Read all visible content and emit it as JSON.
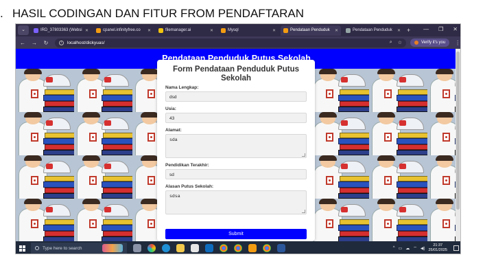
{
  "slide": {
    "number": ".",
    "title": "HASIL CODINGAN DAN FITUR FROM PENDAFTARAN"
  },
  "browser": {
    "tabs": [
      {
        "label": "IRD_37803363 (Websi",
        "color": "#7b61ff",
        "active": false
      },
      {
        "label": "cpanel.infinityfree.co",
        "color": "#f39c12",
        "active": false
      },
      {
        "label": "filemanager.ai",
        "color": "#f1c40f",
        "active": false
      },
      {
        "label": "Mysql",
        "color": "#f39c12",
        "active": false
      },
      {
        "label": "Pendataan Penduduk",
        "color": "#f39c12",
        "active": true
      },
      {
        "label": "Pendataan Penduduk",
        "color": "#95a5a6",
        "active": false
      }
    ],
    "url": "localhost/dickyuas/",
    "verify_label": "Verify it's you"
  },
  "page": {
    "banner": "Pendataan Penduduk Putus Sekolah",
    "form": {
      "title": "Form Pendataan Penduduk Putus Sekolah",
      "fields": [
        {
          "label": "Nama Lengkap:",
          "value": "dsd"
        },
        {
          "label": "Usia:",
          "value": "43"
        },
        {
          "label": "Alamat:",
          "value": "sda"
        },
        {
          "label": "Pendidikan Terakhir:",
          "value": "sd"
        },
        {
          "label": "Alasan Putus Sekolah:",
          "value": "sdsa"
        }
      ],
      "submit": "Submit"
    }
  },
  "taskbar": {
    "search_placeholder": "Type here to search",
    "time": "21:37",
    "date": "25/01/2025"
  }
}
